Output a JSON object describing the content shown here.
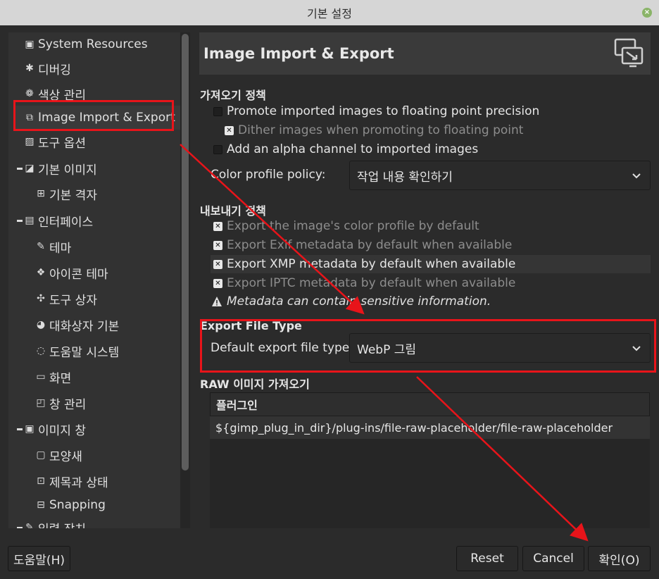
{
  "window": {
    "title": "기본 설정"
  },
  "sidebar": {
    "items": [
      {
        "label": "System Resources"
      },
      {
        "label": "디버깅"
      },
      {
        "label": "색상 관리"
      },
      {
        "label": "Image Import & Export"
      },
      {
        "label": "도구 옵션"
      },
      {
        "label": "기본 이미지"
      },
      {
        "label": "기본 격자"
      },
      {
        "label": "인터페이스"
      },
      {
        "label": "테마"
      },
      {
        "label": "아이콘 테마"
      },
      {
        "label": "도구 상자"
      },
      {
        "label": "대화상자 기본"
      },
      {
        "label": "도움말 시스템"
      },
      {
        "label": "화면"
      },
      {
        "label": "창 관리"
      },
      {
        "label": "이미지 창"
      },
      {
        "label": "모양새"
      },
      {
        "label": "제목과 상태"
      },
      {
        "label": "Snapping"
      },
      {
        "label": "입력 장치"
      }
    ]
  },
  "panel": {
    "title": "Image Import & Export",
    "import_policy": {
      "title": "가져오기 정책",
      "promote_label": "Promote imported images to floating point precision",
      "dither_label": "Dither images when promoting to floating point",
      "alpha_label": "Add an alpha channel to imported images",
      "color_profile_label": "Color profile policy:",
      "color_profile_value": "작업 내용 확인하기"
    },
    "export_policy": {
      "title": "내보내기 정책",
      "color_profile_label": "Export the image's color profile by default",
      "exif_label": "Export Exif metadata by default when available",
      "xmp_label": "Export XMP metadata by default when available",
      "iptc_label": "Export IPTC metadata by default when available",
      "warning": "Metadata can contain sensitive information."
    },
    "export_file_type": {
      "title": "Export File Type",
      "label": "Default export file type:",
      "value": "WebP 그림"
    },
    "raw_import": {
      "title": "RAW 이미지 가져오기",
      "column_header": "플러그인",
      "plugin_path": "${gimp_plug_in_dir}/plug-ins/file-raw-placeholder/file-raw-placeholder"
    }
  },
  "buttons": {
    "help": "도움말(H)",
    "reset": "Reset",
    "cancel": "Cancel",
    "ok": "확인(O)"
  },
  "colors": {
    "annotation": "#e8141a",
    "background": "#2b2b2b"
  }
}
